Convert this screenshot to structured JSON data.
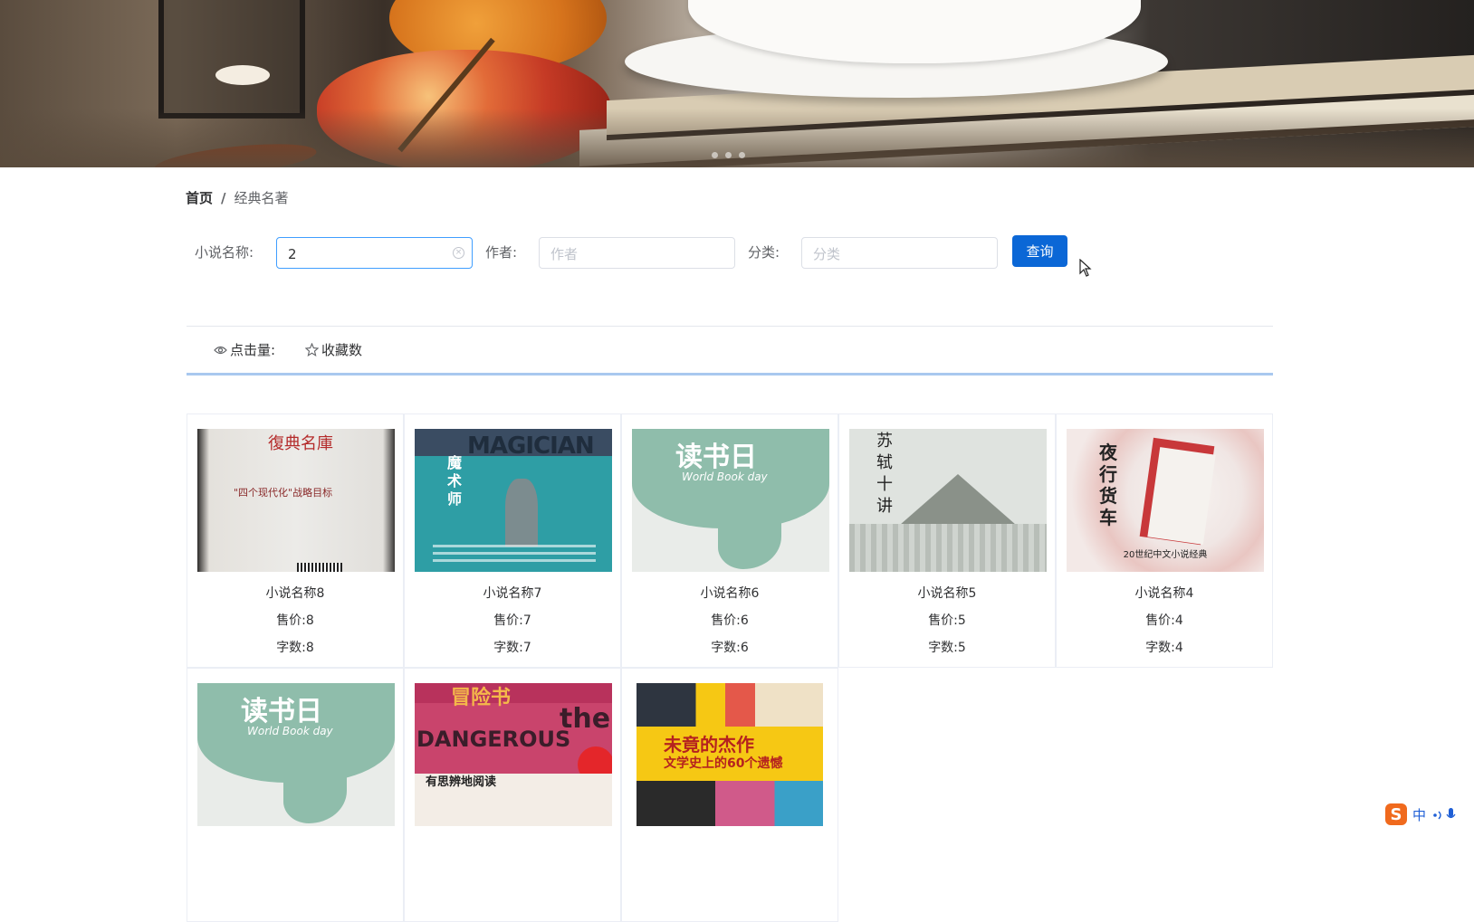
{
  "breadcrumb": {
    "home": "首页",
    "separator": "/",
    "current": "经典名著"
  },
  "search": {
    "name_label": "小说名称:",
    "name_value": "2",
    "author_label": "作者:",
    "author_placeholder": "作者",
    "category_label": "分类:",
    "category_placeholder": "分类",
    "button_label": "查询"
  },
  "sort": [
    {
      "icon": "eye-icon",
      "label": "点击量:"
    },
    {
      "icon": "star-icon",
      "label": "收藏数"
    }
  ],
  "books": [
    {
      "name": "小说名称8",
      "price": "售价:8",
      "words": "字数:8",
      "cover_text": "復典名庫",
      "cover_sub": "\"四个现代化\"战略目标"
    },
    {
      "name": "小说名称7",
      "price": "售价:7",
      "words": "字数:7",
      "cover_text": "MAGICIAN",
      "cover_sub": "魔术师"
    },
    {
      "name": "小说名称6",
      "price": "售价:6",
      "words": "字数:6",
      "cover_text": "读书日",
      "cover_sub": "World Book day"
    },
    {
      "name": "小说名称5",
      "price": "售价:5",
      "words": "字数:5",
      "cover_text": "苏轼十讲"
    },
    {
      "name": "小说名称4",
      "price": "售价:4",
      "words": "字数:4",
      "cover_text": "夜行货车",
      "cover_sub": "20世纪中文小说经典"
    },
    {
      "name": "",
      "price": "",
      "words": "",
      "cover_text": "读书日",
      "cover_sub": "World Book day"
    },
    {
      "name": "",
      "price": "",
      "words": "",
      "cover_text": "冒险书",
      "cover_sub": "DANGEROUS",
      "cover_sub2": "有思辨地阅读"
    },
    {
      "name": "",
      "price": "",
      "words": "",
      "cover_text": "未竟的杰作",
      "cover_sub": "文学史上的60个遗憾"
    }
  ],
  "ime": {
    "logo": "S",
    "mode": "中"
  },
  "colors": {
    "primary": "#0b67d6",
    "sort_underline": "#a9c8ef"
  }
}
